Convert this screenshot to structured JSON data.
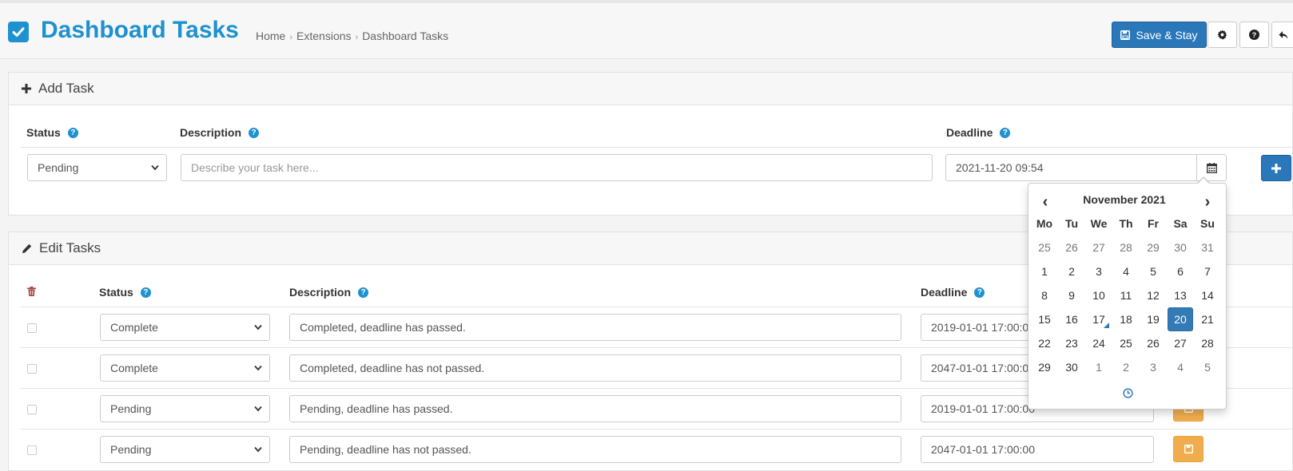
{
  "header": {
    "title": "Dashboard Tasks",
    "breadcrumb": [
      "Home",
      "Extensions",
      "Dashboard Tasks"
    ],
    "breadcrumb_separator": "›",
    "save_stay_label": "Save & Stay",
    "icon_buttons": [
      "gear-icon",
      "question-circle-icon",
      "reply-icon"
    ]
  },
  "add_task": {
    "heading": "Add Task",
    "columns": {
      "status": "Status",
      "description": "Description",
      "deadline": "Deadline"
    },
    "help_glyph": "?",
    "status_value": "Pending",
    "description_placeholder": "Describe your task here...",
    "deadline_value": "2021-11-20 09:54"
  },
  "edit_tasks": {
    "heading": "Edit Tasks",
    "columns": {
      "status": "Status",
      "description": "Description",
      "deadline": "Deadline"
    },
    "help_glyph": "?",
    "rows": [
      {
        "status": "Complete",
        "description": "Completed, deadline has passed.",
        "deadline": "2019-01-01 17:00:00"
      },
      {
        "status": "Complete",
        "description": "Completed, deadline has not passed.",
        "deadline": "2047-01-01 17:00:00"
      },
      {
        "status": "Pending",
        "description": "Pending, deadline has passed.",
        "deadline": "2019-01-01 17:00:00"
      },
      {
        "status": "Pending",
        "description": "Pending, deadline has not passed.",
        "deadline": "2047-01-01 17:00:00"
      }
    ]
  },
  "datepicker": {
    "month_label": "November 2021",
    "prev_glyph": "‹",
    "next_glyph": "›",
    "weekdays": [
      "Mo",
      "Tu",
      "We",
      "Th",
      "Fr",
      "Sa",
      "Su"
    ],
    "weeks": [
      [
        "25",
        "26",
        "27",
        "28",
        "29",
        "30",
        "31"
      ],
      [
        "1",
        "2",
        "3",
        "4",
        "5",
        "6",
        "7"
      ],
      [
        "8",
        "9",
        "10",
        "11",
        "12",
        "13",
        "14"
      ],
      [
        "15",
        "16",
        "17",
        "18",
        "19",
        "20",
        "21"
      ],
      [
        "22",
        "23",
        "24",
        "25",
        "26",
        "27",
        "28"
      ],
      [
        "29",
        "30",
        "1",
        "2",
        "3",
        "4",
        "5"
      ]
    ],
    "selected_day": "20",
    "today_day": "17"
  },
  "colors": {
    "brand": "#1e91cf",
    "primary": "#2a78ba",
    "warning": "#f0ad4e",
    "danger_icon": "#a94442"
  }
}
